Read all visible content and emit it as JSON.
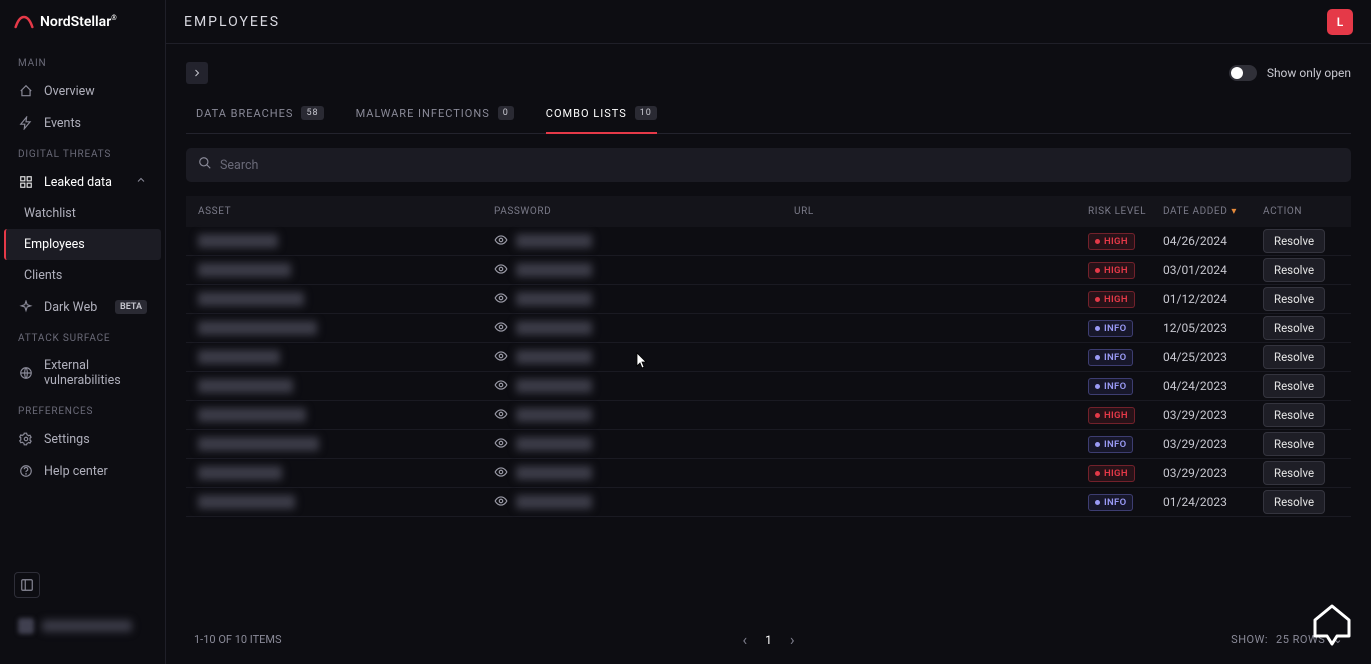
{
  "brand": {
    "name": "NordStellar"
  },
  "header": {
    "title": "EMPLOYEES",
    "avatar_letter": "L"
  },
  "sidebar": {
    "sections": {
      "main": "MAIN",
      "digital_threats": "DIGITAL THREATS",
      "attack_surface": "ATTACK SURFACE",
      "preferences": "PREFERENCES"
    },
    "items": {
      "overview": "Overview",
      "events": "Events",
      "leaked_data": "Leaked data",
      "watchlist": "Watchlist",
      "employees": "Employees",
      "clients": "Clients",
      "dark_web": "Dark Web",
      "dark_web_badge": "BETA",
      "external_vuln": "External vulnerabilities",
      "settings": "Settings",
      "help_center": "Help center"
    }
  },
  "toggle": {
    "label": "Show only open"
  },
  "tabs": [
    {
      "label": "DATA BREACHES",
      "count": "58",
      "active": false
    },
    {
      "label": "MALWARE INFECTIONS",
      "count": "0",
      "active": false
    },
    {
      "label": "COMBO LISTS",
      "count": "10",
      "active": true
    }
  ],
  "search": {
    "placeholder": "Search"
  },
  "columns": {
    "asset": "ASSET",
    "password": "PASSWORD",
    "url": "URL",
    "risk": "RISK LEVEL",
    "date": "DATE ADDED",
    "action": "ACTION"
  },
  "rows": [
    {
      "risk": "HIGH",
      "date": "04/26/2024"
    },
    {
      "risk": "HIGH",
      "date": "03/01/2024"
    },
    {
      "risk": "HIGH",
      "date": "01/12/2024"
    },
    {
      "risk": "INFO",
      "date": "12/05/2023"
    },
    {
      "risk": "INFO",
      "date": "04/25/2023"
    },
    {
      "risk": "INFO",
      "date": "04/24/2023"
    },
    {
      "risk": "HIGH",
      "date": "03/29/2023"
    },
    {
      "risk": "INFO",
      "date": "03/29/2023"
    },
    {
      "risk": "HIGH",
      "date": "03/29/2023"
    },
    {
      "risk": "INFO",
      "date": "01/24/2023"
    }
  ],
  "action_label": "Resolve",
  "footer": {
    "summary": "1-10 OF 10 ITEMS",
    "page": "1",
    "show_label": "SHOW:",
    "show_value": "25 rows"
  }
}
